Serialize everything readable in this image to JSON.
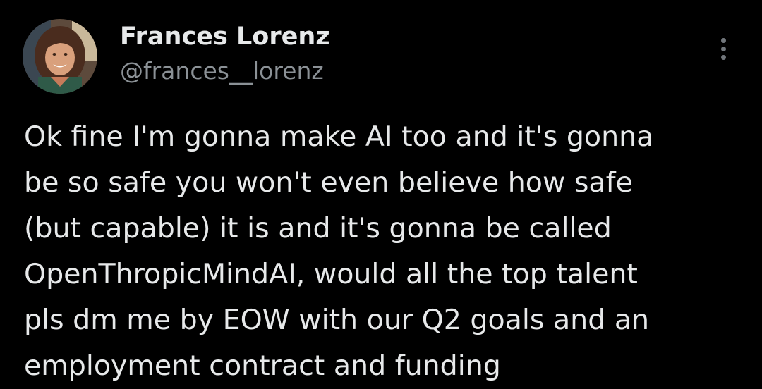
{
  "author": {
    "name": "Frances Lorenz",
    "handle": "@frances__lorenz",
    "avatar_icon": "profile-photo"
  },
  "menu": {
    "icon": "vertical-ellipsis-icon"
  },
  "tweet": {
    "lines": [
      "Ok fine I'm gonna make AI too and it's gonna",
      "be so safe you won't even believe how safe",
      "(but capable) it is and it's gonna be called",
      "OpenThropicMindAI, would all the top talent",
      "pls dm me by EOW with our Q2 goals and an",
      "employment contract and funding"
    ]
  },
  "colors": {
    "background": "#000000",
    "primary_text": "#e7e9ea",
    "secondary_text": "#8b9196"
  }
}
